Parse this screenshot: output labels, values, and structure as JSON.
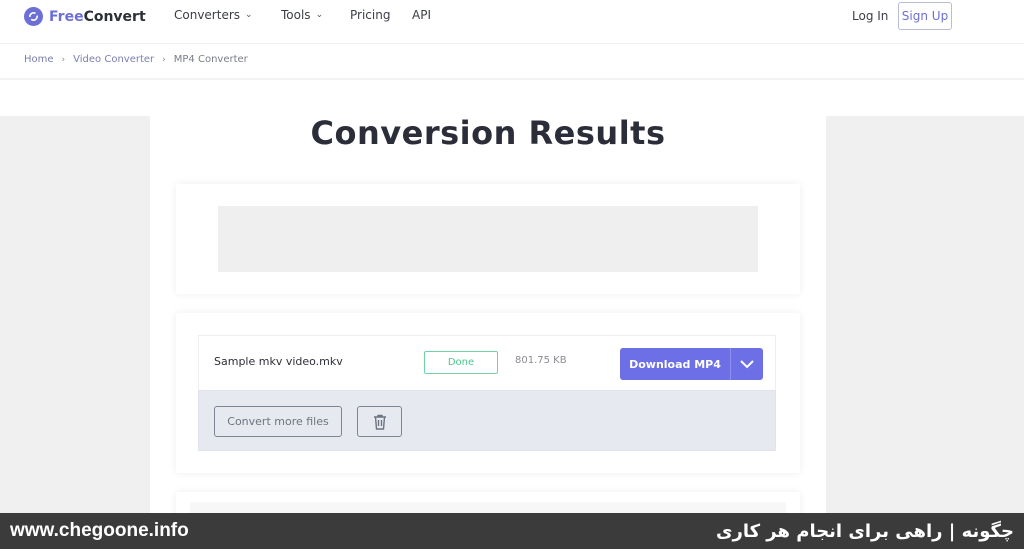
{
  "brand": {
    "name_part1": "Free",
    "name_part2": "Convert"
  },
  "nav": {
    "items": [
      {
        "label": "Converters",
        "has_dropdown": true
      },
      {
        "label": "Tools",
        "has_dropdown": true
      },
      {
        "label": "Pricing",
        "has_dropdown": false
      },
      {
        "label": "API",
        "has_dropdown": false
      }
    ],
    "login": "Log In",
    "signup": "Sign Up"
  },
  "breadcrumb": [
    "Home",
    "Video Converter",
    "MP4 Converter"
  ],
  "page": {
    "title": "Conversion Results"
  },
  "file": {
    "name": "Sample mkv video.mkv",
    "status": "Done",
    "size": "801.75 KB",
    "download_label": "Download MP4"
  },
  "actions": {
    "convert_more": "Convert more files"
  },
  "colors": {
    "accent": "#6c6fe6",
    "success": "#4cc78c"
  },
  "footer": {
    "url": "www.chegoone.info",
    "tagline": "چگونه | راهی برای انجام هر کاری"
  }
}
